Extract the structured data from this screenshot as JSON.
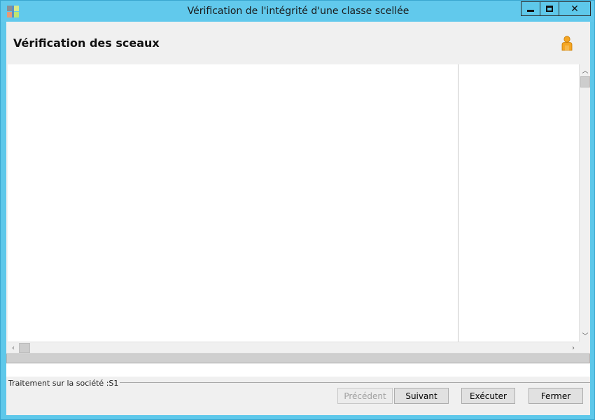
{
  "window": {
    "title": "Vérification de l'intégrité d'une classe scellée",
    "controls": {
      "minimize": "minimize-icon",
      "maximize": "maximize-icon",
      "close": "close-icon"
    }
  },
  "header": {
    "title": "Vérification des sceaux",
    "icon": "user-icon"
  },
  "progress": {
    "value": 0
  },
  "status": {
    "text": "Traitement sur la société :S1"
  },
  "buttons": {
    "previous": "Précédent",
    "next": "Suivant",
    "execute": "Exécuter",
    "close": "Fermer"
  },
  "colors": {
    "titlebar": "#61c9ec",
    "client": "#f0f0f0",
    "user_icon": "#f5a623"
  }
}
